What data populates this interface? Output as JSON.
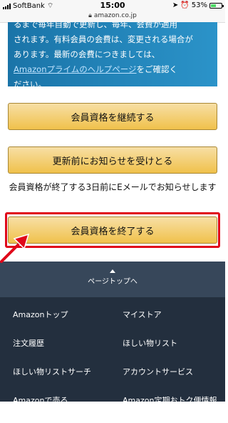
{
  "status_bar": {
    "carrier": "SoftBank",
    "time": "15:00",
    "battery": "53%",
    "battery_level": 0.53
  },
  "url_bar": {
    "url": "amazon.co.jp"
  },
  "notice": {
    "line1": "るまで毎年自動で更新し、毎年、会費が適用",
    "line2": "されます。有料会員の会費は、変更される場合が",
    "line3": "あります。最新の会費につきましては、",
    "link": "Amazonプライムのヘルプページ",
    "after_link": "をご確認く",
    "line5": "ださい。"
  },
  "buttons": {
    "continue": "会員資格を継続する",
    "notify": "更新前にお知らせを受けとる",
    "end": "会員資格を終了する"
  },
  "info_text": "会員資格が終了する3日前にEメールでお知らせします",
  "footer": {
    "back_to_top": "ページトップへ",
    "links": [
      [
        "Amazonトップ",
        "マイストア"
      ],
      [
        "注文履歴",
        "ほしい物リスト"
      ],
      [
        "ほしい物リストサーチ",
        "アカウントサービス"
      ],
      [
        "Amazonで売る",
        "Amazon定期おトク便情報"
      ]
    ]
  },
  "colors": {
    "highlight": "#e0081a",
    "button": "#f0c14b",
    "footer": "#232f3e"
  }
}
